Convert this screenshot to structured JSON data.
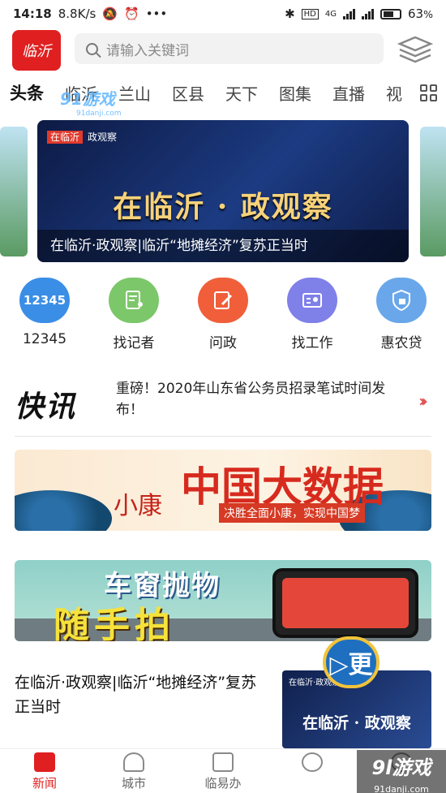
{
  "status_bar": {
    "time": "14:18",
    "speed": "8.8K/s",
    "dots": "•••",
    "hd": "HD",
    "net": "4G",
    "battery": "63"
  },
  "header": {
    "logo_text": "临沂",
    "search_placeholder": "请输入关键词"
  },
  "tabs": [
    {
      "label": "头条",
      "active": true
    },
    {
      "label": "临沂"
    },
    {
      "label": "兰山"
    },
    {
      "label": "区县"
    },
    {
      "label": "天下"
    },
    {
      "label": "图集"
    },
    {
      "label": "直播"
    },
    {
      "label": "视"
    }
  ],
  "carousel": {
    "tag_logo": "在临沂",
    "tag_text": "政观察",
    "title": "在临沂 · 政观察",
    "caption": "在临沂·政观察|临沂“地摊经济”复苏正当时"
  },
  "quick_links": [
    {
      "label": "12345",
      "icon": "12345",
      "color": "#3a8ee6"
    },
    {
      "label": "找记者",
      "icon": "doc-person-icon",
      "color": "#7cc76a"
    },
    {
      "label": "问政",
      "icon": "pen-icon",
      "color": "#f05f3a"
    },
    {
      "label": "找工作",
      "icon": "id-card-icon",
      "color": "#7f80e8"
    },
    {
      "label": "惠农贷",
      "icon": "shield-icon",
      "color": "#6aa7ea"
    }
  ],
  "flash_news": {
    "logo": "快讯",
    "text": "重磅！2020年山东省公务员招录笔试时间发布！",
    "arrow": "›››"
  },
  "promo1": {
    "big": "中国大数据",
    "small": "小康",
    "sub": "决胜全面小康，实现中国梦"
  },
  "promo2": {
    "line1": "车窗抛物",
    "line2": "随手拍"
  },
  "article": {
    "title": "在临沂·政观察|临沂“地摊经济”复苏正当时",
    "thumb_tag": "在临沂·政观察",
    "thumb_title": "在临沂 · 政观察",
    "badge": "▷更"
  },
  "bottom_nav": [
    {
      "label": "新闻",
      "active": true
    },
    {
      "label": "城市"
    },
    {
      "label": "临易办"
    },
    {
      "label": ""
    },
    {
      "label": ""
    }
  ],
  "watermark": {
    "top": "91游戏",
    "top_sub": "91danji.com",
    "bottom": "9l游戏",
    "bottom_sub": "91danji.com"
  }
}
